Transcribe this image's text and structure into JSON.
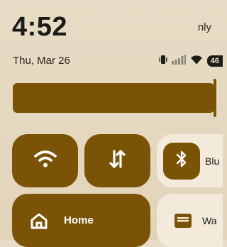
{
  "status_bar": {
    "time": "4:52",
    "carrier_text": "nly",
    "date": "Thu, Mar 26",
    "battery": "46"
  },
  "brightness": {
    "level": 0.96
  },
  "quick_settings": {
    "tiles": [
      {
        "id": "wifi",
        "icon": "wifi-icon",
        "state": "on"
      },
      {
        "id": "data",
        "icon": "data-transfer-icon",
        "state": "on"
      },
      {
        "id": "bluetooth",
        "icon": "bluetooth-icon",
        "label": "Blu",
        "state": "off"
      },
      {
        "id": "home",
        "icon": "home-icon",
        "label": "Home",
        "state": "on"
      },
      {
        "id": "wallet",
        "icon": "wallet-icon",
        "label": "Wa",
        "state": "off"
      }
    ]
  },
  "colors": {
    "accent": "#7b5307",
    "background": "#e6d9c1",
    "tile_off": "#f3eadb"
  }
}
